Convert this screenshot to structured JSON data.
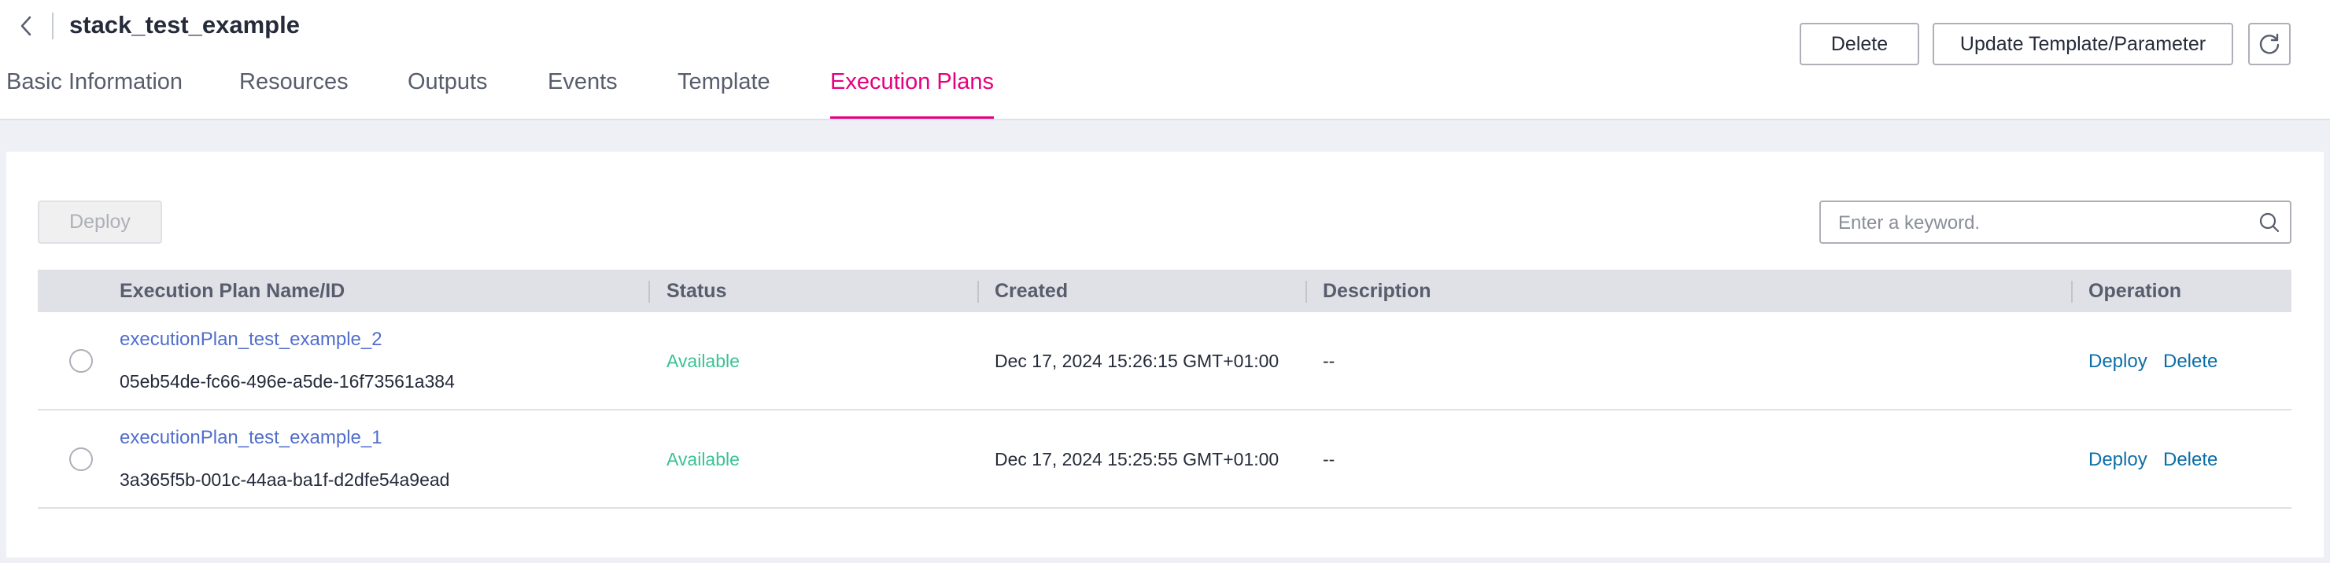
{
  "header": {
    "title": "stack_test_example",
    "delete_label": "Delete",
    "update_label": "Update Template/Parameter"
  },
  "tabs": [
    {
      "label": "Basic Information",
      "active": false
    },
    {
      "label": "Resources",
      "active": false
    },
    {
      "label": "Outputs",
      "active": false
    },
    {
      "label": "Events",
      "active": false
    },
    {
      "label": "Template",
      "active": false
    },
    {
      "label": "Execution Plans",
      "active": true
    }
  ],
  "toolbar": {
    "deploy_label": "Deploy",
    "search_placeholder": "Enter a keyword."
  },
  "table": {
    "columns": [
      "Execution Plan Name/ID",
      "Status",
      "Created",
      "Description",
      "Operation"
    ],
    "rows": [
      {
        "name": "executionPlan_test_example_2",
        "id": "05eb54de-fc66-496e-a5de-16f73561a384",
        "status": "Available",
        "created": "Dec 17, 2024 15:26:15 GMT+01:00",
        "description": "--",
        "op_deploy": "Deploy",
        "op_delete": "Delete"
      },
      {
        "name": "executionPlan_test_example_1",
        "id": "3a365f5b-001c-44aa-ba1f-d2dfe54a9ead",
        "status": "Available",
        "created": "Dec 17, 2024 15:25:55 GMT+01:00",
        "description": "--",
        "op_deploy": "Deploy",
        "op_delete": "Delete"
      }
    ]
  },
  "icons": {
    "back": "chevron-left-icon",
    "refresh": "refresh-icon",
    "search": "search-icon"
  },
  "colors": {
    "accent": "#e6007e",
    "link": "#526ecc",
    "operation_link": "#0b6ea8",
    "status_available": "#3ac295"
  }
}
